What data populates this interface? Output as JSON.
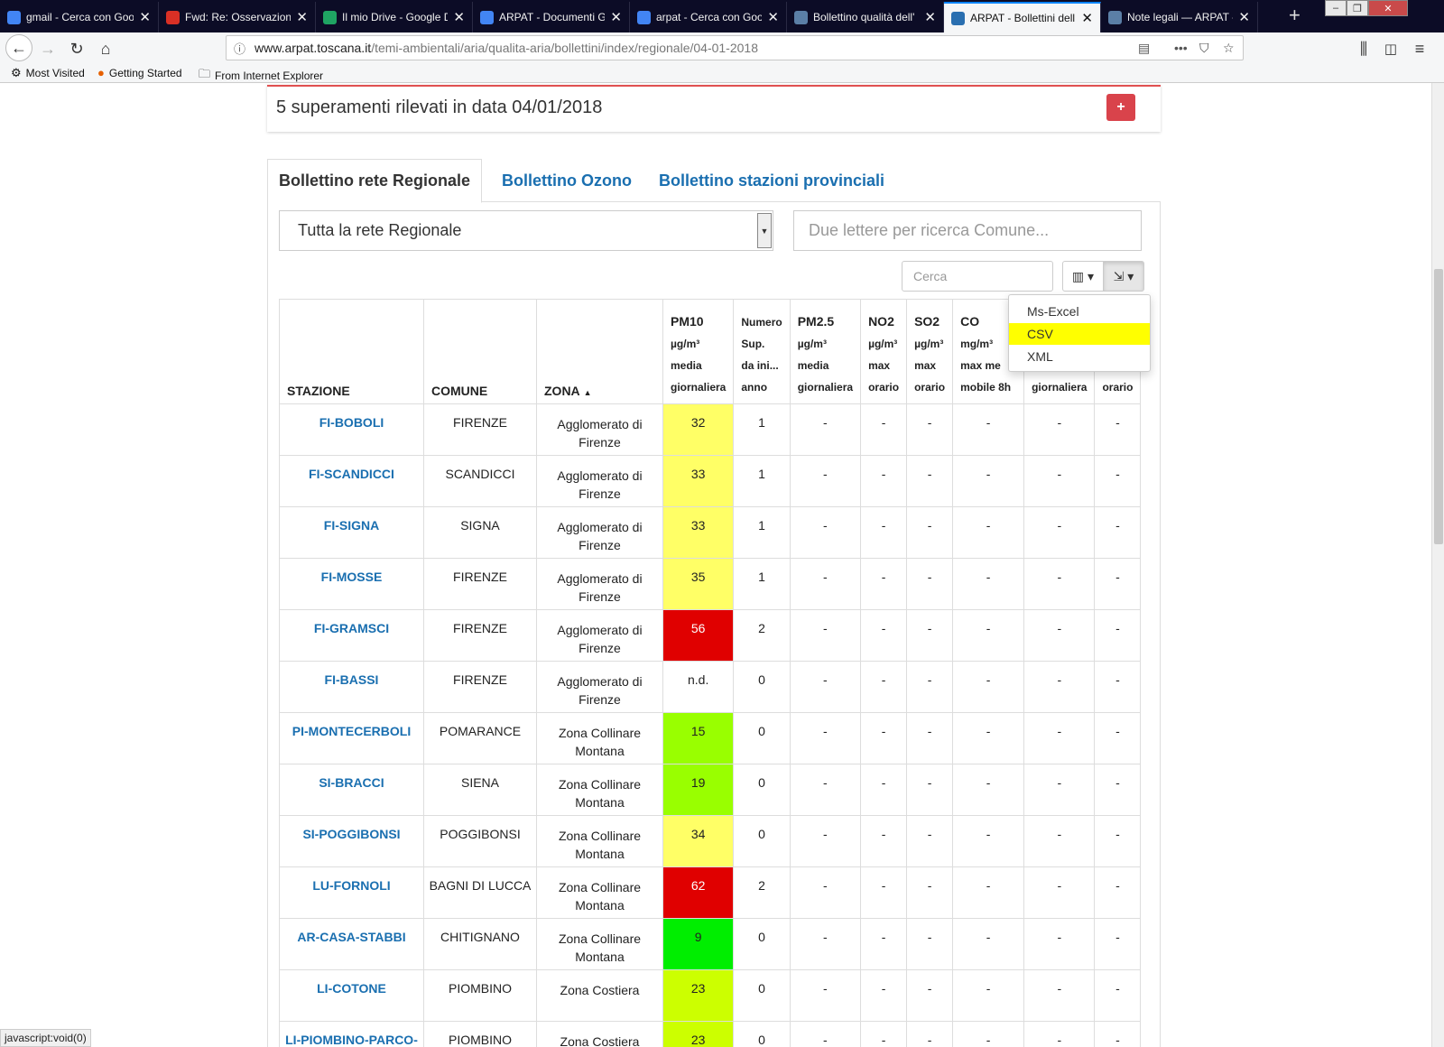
{
  "browser": {
    "tabs": [
      {
        "title": "gmail - Cerca con Goo",
        "icon": "google-icon",
        "color": "#4285f4"
      },
      {
        "title": "Fwd: Re: Osservazioni",
        "icon": "gmail-icon",
        "color": "#d93025"
      },
      {
        "title": "Il mio Drive - Google D",
        "icon": "drive-icon",
        "color": "#1fa463"
      },
      {
        "title": "ARPAT - Documenti G",
        "icon": "docs-icon",
        "color": "#4285f4"
      },
      {
        "title": "arpat - Cerca con Goo",
        "icon": "google-icon",
        "color": "#4285f4"
      },
      {
        "title": "Bollettino qualità dell'",
        "icon": "page-icon",
        "color": "#5b7fa6"
      },
      {
        "title": "ARPAT - Bollettini dell",
        "icon": "arpat-icon",
        "color": "#2a6fb0"
      },
      {
        "title": "Note legali — ARPAT -",
        "icon": "page-icon",
        "color": "#5b7fa6"
      }
    ],
    "url_host": "www.arpat.toscana.it",
    "url_path": "/temi-ambientali/aria/qualita-aria/bollettini/index/regionale/04-01-2018",
    "bookmarks": [
      "Most Visited",
      "Getting Started",
      "From Internet Explorer"
    ],
    "status": "javascript:void(0)"
  },
  "alert": {
    "text": "5 superamenti rilevati in data 04/01/2018",
    "button": "+"
  },
  "page_tabs": [
    "Bollettino rete Regionale",
    "Bollettino Ozono",
    "Bollettino stazioni provinciali"
  ],
  "filters": {
    "rete": "Tutta la rete Regionale",
    "comune_placeholder": "Due lettere per ricerca Comune...",
    "cerca_placeholder": "Cerca"
  },
  "export_menu": [
    "Ms-Excel",
    "CSV",
    "XML"
  ],
  "table": {
    "headers": {
      "stazione": "STAZIONE",
      "comune": "COMUNE",
      "zona": "ZONA",
      "pm10": [
        "PM10",
        "µg/m³",
        "media",
        "giornaliera"
      ],
      "numsup": [
        "Numero",
        "Sup.",
        "da ini...",
        "anno"
      ],
      "pm25": [
        "PM2.5",
        "µg/m³",
        "media",
        "giornaliera"
      ],
      "no2": [
        "NO2",
        "µg/m³",
        "max",
        "orario"
      ],
      "so2": [
        "SO2",
        "µg/m³",
        "max",
        "orario"
      ],
      "co": [
        "CO",
        "mg/m³",
        "max me",
        "mobile 8h"
      ],
      "col9": [
        "",
        "",
        "",
        "giornaliera"
      ],
      "col10": [
        "",
        "",
        "",
        "orario"
      ]
    },
    "rows": [
      {
        "stazione": "FI-BOBOLI",
        "comune": "FIRENZE",
        "zona": [
          "Agglomerato di",
          "Firenze"
        ],
        "pm10": "32",
        "pm10_color": "#ffff66",
        "sup": "1"
      },
      {
        "stazione": "FI-SCANDICCI",
        "comune": "SCANDICCI",
        "zona": [
          "Agglomerato di",
          "Firenze"
        ],
        "pm10": "33",
        "pm10_color": "#ffff66",
        "sup": "1"
      },
      {
        "stazione": "FI-SIGNA",
        "comune": "SIGNA",
        "zona": [
          "Agglomerato di",
          "Firenze"
        ],
        "pm10": "33",
        "pm10_color": "#ffff66",
        "sup": "1"
      },
      {
        "stazione": "FI-MOSSE",
        "comune": "FIRENZE",
        "zona": [
          "Agglomerato di",
          "Firenze"
        ],
        "pm10": "35",
        "pm10_color": "#ffff66",
        "sup": "1"
      },
      {
        "stazione": "FI-GRAMSCI",
        "comune": "FIRENZE",
        "zona": [
          "Agglomerato di",
          "Firenze"
        ],
        "pm10": "56",
        "pm10_color": "#e00000",
        "pm10_text": "#ffffff",
        "sup": "2"
      },
      {
        "stazione": "FI-BASSI",
        "comune": "FIRENZE",
        "zona": [
          "Agglomerato di",
          "Firenze"
        ],
        "pm10": "n.d.",
        "pm10_color": "#ffffff",
        "sup": "0"
      },
      {
        "stazione": "PI-MONTECERBOLI",
        "comune": "POMARANCE",
        "zona": [
          "Zona Collinare",
          "Montana"
        ],
        "pm10": "15",
        "pm10_color": "#99ff00",
        "sup": "0"
      },
      {
        "stazione": "SI-BRACCI",
        "comune": "SIENA",
        "zona": [
          "Zona Collinare",
          "Montana"
        ],
        "pm10": "19",
        "pm10_color": "#99ff00",
        "sup": "0"
      },
      {
        "stazione": "SI-POGGIBONSI",
        "comune": "POGGIBONSI",
        "zona": [
          "Zona Collinare",
          "Montana"
        ],
        "pm10": "34",
        "pm10_color": "#ffff66",
        "sup": "0"
      },
      {
        "stazione": "LU-FORNOLI",
        "comune": "BAGNI DI LUCCA",
        "zona": [
          "Zona Collinare",
          "Montana"
        ],
        "pm10": "62",
        "pm10_color": "#e00000",
        "pm10_text": "#ffffff",
        "sup": "2"
      },
      {
        "stazione": "AR-CASA-STABBI",
        "comune": "CHITIGNANO",
        "zona": [
          "Zona Collinare",
          "Montana"
        ],
        "pm10": "9",
        "pm10_color": "#00ee00",
        "sup": "0"
      },
      {
        "stazione": "LI-COTONE",
        "comune": "PIOMBINO",
        "zona": [
          "Zona Costiera",
          ""
        ],
        "pm10": "23",
        "pm10_color": "#ccff00",
        "sup": "0"
      },
      {
        "stazione": "LI-PIOMBINO-PARCO-",
        "comune": "PIOMBINO",
        "zona": [
          "Zona Costiera",
          ""
        ],
        "pm10": "23",
        "pm10_color": "#ccff00",
        "sup": "0"
      }
    ],
    "empty_cell": "-"
  }
}
